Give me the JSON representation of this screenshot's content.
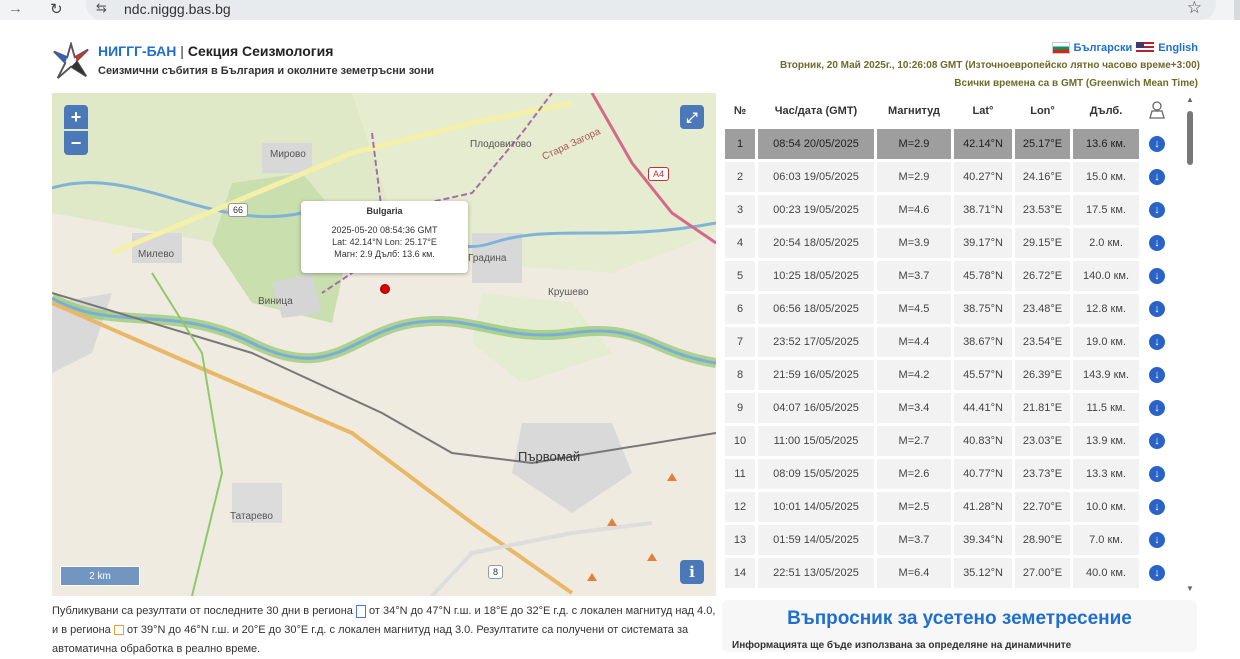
{
  "browser": {
    "url": "ndc.niggg.bas.bg"
  },
  "header": {
    "org_name": "НИГГГ-БАН",
    "separator": "|",
    "section_name": "Секция Сеизмология",
    "subtitle": "Сеизмични събития в България и околните земетръсни зони",
    "lang_bg": "Български",
    "lang_en": "English",
    "datetime": "Вторник, 20 Май 2025г., 10:26:08 GMT (Източноевропейско лятно часово време+3:00)",
    "gmt_note": "Всички времена са в GMT (Greenwich Mean Time)"
  },
  "map": {
    "zoom_in": "+",
    "zoom_out": "−",
    "scale": "2 km",
    "popup": {
      "title": "Bulgaria",
      "line1": "2025-05-20 08:54:36 GMT",
      "line2": "Lat: 42.14°N Lon: 25.17°E",
      "line3": "Магн: 2.9 Дълб: 13.6 км."
    },
    "places": [
      "Мирово",
      "Плодовитово",
      "Милево",
      "Виница",
      "Градина",
      "Крушево",
      "Първомай",
      "Татарево",
      "Стара Загора"
    ],
    "roads": [
      "66",
      "A4",
      "8"
    ]
  },
  "table": {
    "headers": [
      "№",
      "Час/дата (GMT)",
      "Магнитуд",
      "Lat°",
      "Lon°",
      "Дълб."
    ],
    "rows": [
      {
        "n": "1",
        "time": "08:54 20/05/2025",
        "mag": "M=2.9",
        "lat": "42.14°N",
        "lon": "25.17°E",
        "depth": "13.6 км."
      },
      {
        "n": "2",
        "time": "06:03 19/05/2025",
        "mag": "M=2.9",
        "lat": "40.27°N",
        "lon": "24.16°E",
        "depth": "15.0 км."
      },
      {
        "n": "3",
        "time": "00:23 19/05/2025",
        "mag": "M=4.6",
        "lat": "38.71°N",
        "lon": "23.53°E",
        "depth": "17.5 км."
      },
      {
        "n": "4",
        "time": "20:54 18/05/2025",
        "mag": "M=3.9",
        "lat": "39.17°N",
        "lon": "29.15°E",
        "depth": "2.0 км."
      },
      {
        "n": "5",
        "time": "10:25 18/05/2025",
        "mag": "M=3.7",
        "lat": "45.78°N",
        "lon": "26.72°E",
        "depth": "140.0 км."
      },
      {
        "n": "6",
        "time": "06:56 18/05/2025",
        "mag": "M=4.5",
        "lat": "38.75°N",
        "lon": "23.48°E",
        "depth": "12.8 км."
      },
      {
        "n": "7",
        "time": "23:52 17/05/2025",
        "mag": "M=4.4",
        "lat": "38.67°N",
        "lon": "23.54°E",
        "depth": "19.0 км."
      },
      {
        "n": "8",
        "time": "21:59 16/05/2025",
        "mag": "M=4.2",
        "lat": "45.57°N",
        "lon": "26.39°E",
        "depth": "143.9 км."
      },
      {
        "n": "9",
        "time": "04:07 16/05/2025",
        "mag": "M=3.4",
        "lat": "44.41°N",
        "lon": "21.81°E",
        "depth": "11.5 км."
      },
      {
        "n": "10",
        "time": "11:00 15/05/2025",
        "mag": "M=2.7",
        "lat": "40.83°N",
        "lon": "23.03°E",
        "depth": "13.9 км."
      },
      {
        "n": "11",
        "time": "08:09 15/05/2025",
        "mag": "M=2.6",
        "lat": "40.77°N",
        "lon": "23.73°E",
        "depth": "13.3 км."
      },
      {
        "n": "12",
        "time": "10:01 14/05/2025",
        "mag": "M=2.5",
        "lat": "41.28°N",
        "lon": "22.70°E",
        "depth": "10.0 км."
      },
      {
        "n": "13",
        "time": "01:59 14/05/2025",
        "mag": "M=3.7",
        "lat": "39.34°N",
        "lon": "28.90°E",
        "depth": "7.0 км."
      },
      {
        "n": "14",
        "time": "22:51 13/05/2025",
        "mag": "M=6.4",
        "lat": "35.12°N",
        "lon": "27.00°E",
        "depth": "40.0 км."
      }
    ]
  },
  "description": {
    "part1": "Публикувани са резултати от последните 30 дни в региона",
    "part2": "от 34°N до 47°N г.ш. и 18°E до 32°E г.д. с локален магнитуд над 4.0, и в региона",
    "part3": "от 39°N до 46°N г.ш. и 20°E до 30°E г.д. с локален магнитуд над 3.0. Резултатите са получени от системата за автоматична обработка в реално време."
  },
  "survey": {
    "title": "Въпросник за усетено земетресение",
    "note": "Информацията ще бъде използвана за определяне на динамичните"
  },
  "colors": {
    "accent": "#1f6fd0",
    "selected_row": "#9e9e9e",
    "quake_marker": "#dd0000"
  }
}
